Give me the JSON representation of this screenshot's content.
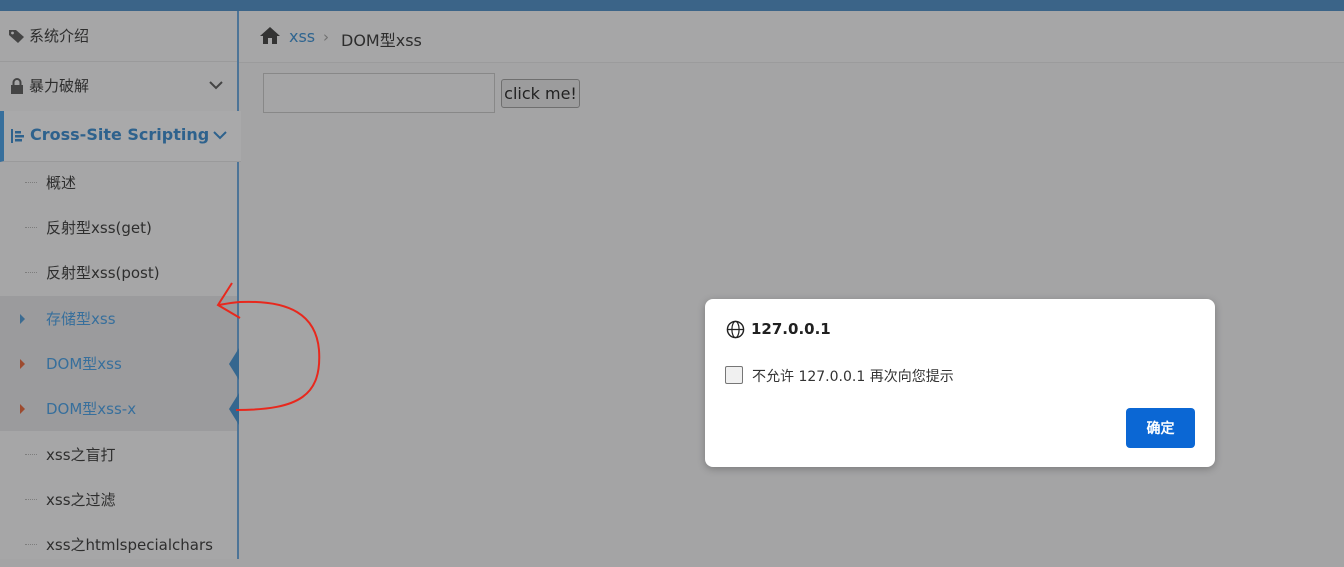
{
  "sidebar": {
    "intro": "系统介绍",
    "brute": "暴力破解",
    "xss": "Cross-Site Scripting",
    "sub_items": [
      "概述",
      "反射型xss(get)",
      "反射型xss(post)",
      "存储型xss",
      "DOM型xss",
      "DOM型xss-x",
      "xss之盲打",
      "xss之过滤",
      "xss之htmlspecialchars"
    ]
  },
  "breadcrumb": {
    "link": "xss",
    "sep": "›",
    "current": "DOM型xss"
  },
  "main": {
    "input_value": "",
    "button_label": "click me!"
  },
  "dialog": {
    "title": "127.0.0.1",
    "checkbox_label": "不允许 127.0.0.1 再次向您提示",
    "ok_label": "确定"
  },
  "colors": {
    "accent": "#0b67d4",
    "topbar": "#3b6488",
    "annotation": "#e8281d"
  }
}
